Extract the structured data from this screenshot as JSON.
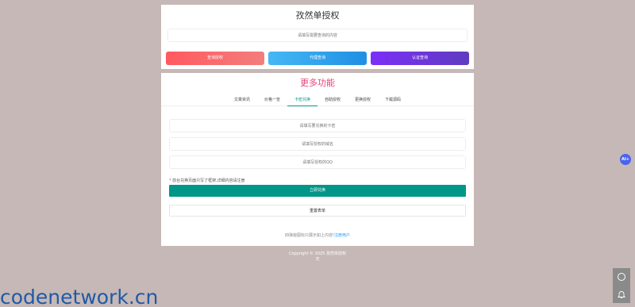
{
  "top_card": {
    "title": "孜然单授权",
    "query_placeholder": "请填写需要查询的内容",
    "buttons": {
      "query": "查询授权",
      "agent": "代理查询",
      "verify": "认证查询"
    }
  },
  "more_card": {
    "title": "更多功能",
    "tabs": [
      "文章资讯",
      "价格一览",
      "卡密兑换",
      "自助授权",
      "更换授权",
      "下载源码"
    ],
    "active_tab": "卡密兑换",
    "card_placeholder": "请填写要兑换的卡密",
    "domain_placeholder": "请填写授权的域名",
    "qq_placeholder": "请填写授权的QQ",
    "notice_star": "*",
    "notice": "前台兑换页面只写了框架,详细内容请注册",
    "exchange_label": "立即兑换",
    "reset_label": "重置表单",
    "register_text": "四弹窗图标只展示如上内容!",
    "register_link": "注册用户"
  },
  "footer": {
    "copyright": "Copyright © 2025 孜然单授权",
    "line2": "无"
  },
  "ai_bubble": "AI+",
  "watermark": "codenetwork.cn",
  "colors": {
    "background": "#c6b8b6",
    "accent_teal": "#009688",
    "title_pink": "#e8427a",
    "link_blue": "#1e9fff"
  }
}
